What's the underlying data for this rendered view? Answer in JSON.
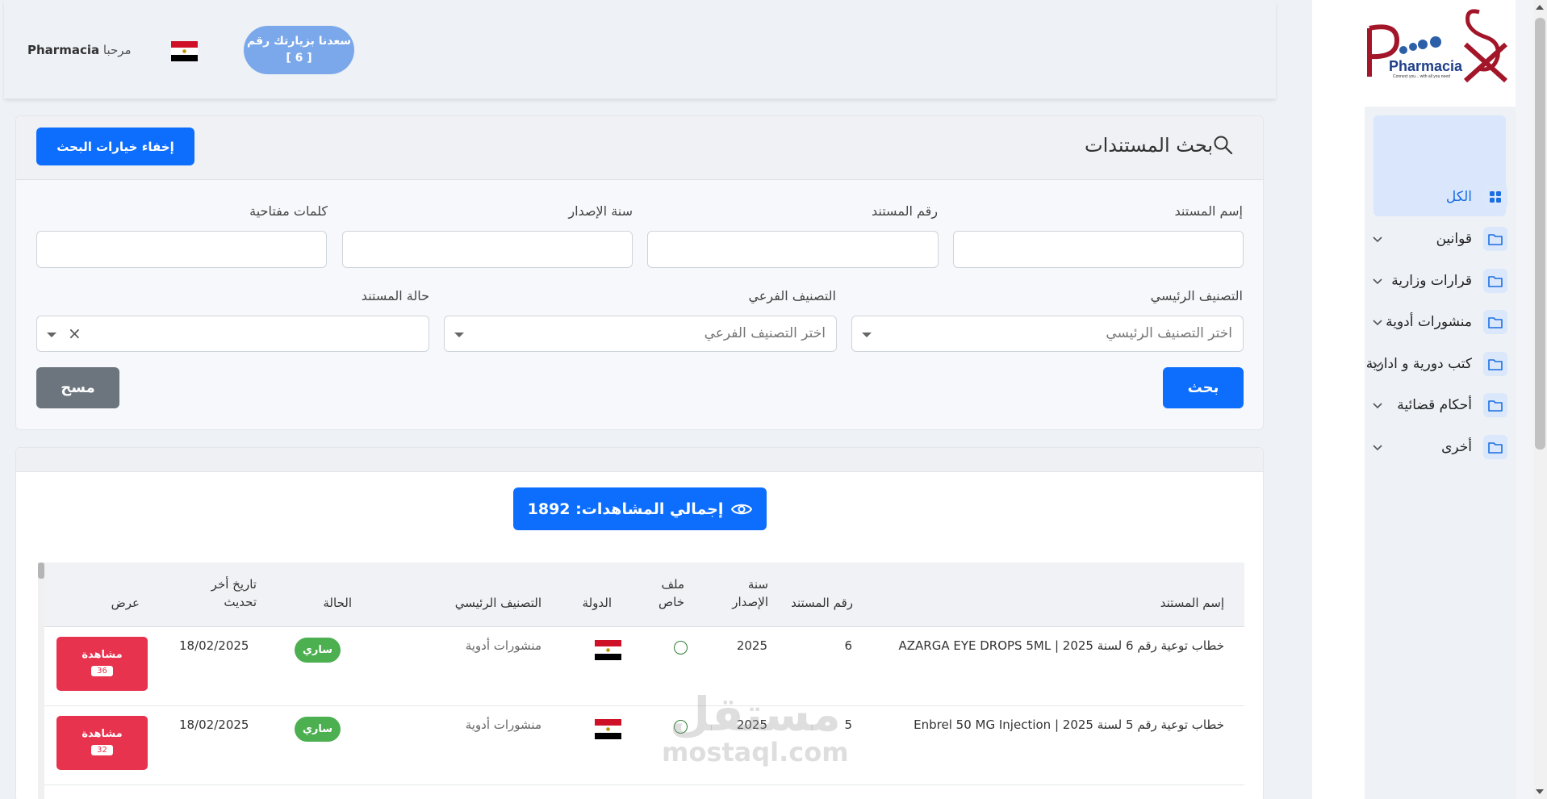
{
  "header": {
    "visit_line1": "سعدنا بزيارتك رقم",
    "visit_line2": "[ 6 ]",
    "welcome_prefix": "مرحبا",
    "welcome_name": "Pharmacia"
  },
  "logo": {
    "text": "Pharmacia",
    "tagline": "Connect you... with all you need"
  },
  "sidebar": {
    "items": [
      {
        "label": "الكل",
        "icon": "grid-icon",
        "active": true
      },
      {
        "label": "قوانين",
        "icon": "folder-icon"
      },
      {
        "label": "قرارات وزارية",
        "icon": "folder-icon"
      },
      {
        "label": "منشورات أدوية",
        "icon": "folder-icon"
      },
      {
        "label": "كتب دورية و ادارية",
        "icon": "folder-icon"
      },
      {
        "label": "أحكام قضائية",
        "icon": "folder-icon"
      },
      {
        "label": "أخرى",
        "icon": "folder-icon"
      }
    ]
  },
  "search": {
    "title": "بحث المستندات",
    "hide_options": "إخفاء خيارات البحث",
    "labels": {
      "doc_name": "إسم المستند",
      "doc_number": "رقم المستند",
      "issue_year": "سنة الإصدار",
      "keywords": "كلمات مفتاحية",
      "main_category": "التصنيف الرئيسي",
      "sub_category": "التصنيف الفرعي",
      "doc_status": "حالة المستند"
    },
    "placeholders": {
      "main_category": "اختر التصنيف الرئيسي",
      "sub_category": "اختر التصنيف الفرعي"
    },
    "search_button": "بحث",
    "clear_button": "مسح"
  },
  "results": {
    "total_views_label": "إجمالي المشاهدات: 1892",
    "columns": {
      "name": "إسم المستند",
      "number": "رقم المستند",
      "year_l1": "سنة",
      "year_l2": "الإصدار",
      "file_l1": "ملف",
      "file_l2": "خاص",
      "country": "الدولة",
      "category": "التصنيف الرئيسي",
      "status": "الحالة",
      "updated_l1": "تاريخ أخر",
      "updated_l2": "تحديث",
      "view": "عرض"
    },
    "rows": [
      {
        "name": "خطاب توعية رقم 6 لسنة 2025 | AZARGA EYE DROPS 5ML",
        "number": "6",
        "year": "2025",
        "category": "منشورات أدوية",
        "status": "ساري",
        "updated": "18/02/2025",
        "view_label": "مشاهدة",
        "view_count": "36"
      },
      {
        "name": "خطاب توعية رقم 5 لسنة 2025 | Enbrel 50 MG Injection",
        "number": "5",
        "year": "2025",
        "category": "منشورات أدوية",
        "status": "ساري",
        "updated": "18/02/2025",
        "view_label": "مشاهدة",
        "view_count": "32"
      }
    ]
  },
  "watermark": {
    "arabic": "مستقل",
    "latin": "mostaql.com"
  },
  "colors": {
    "primary": "#0d6efd",
    "danger": "#e8334f",
    "success": "#4caf50",
    "secondary": "#6c757d"
  }
}
